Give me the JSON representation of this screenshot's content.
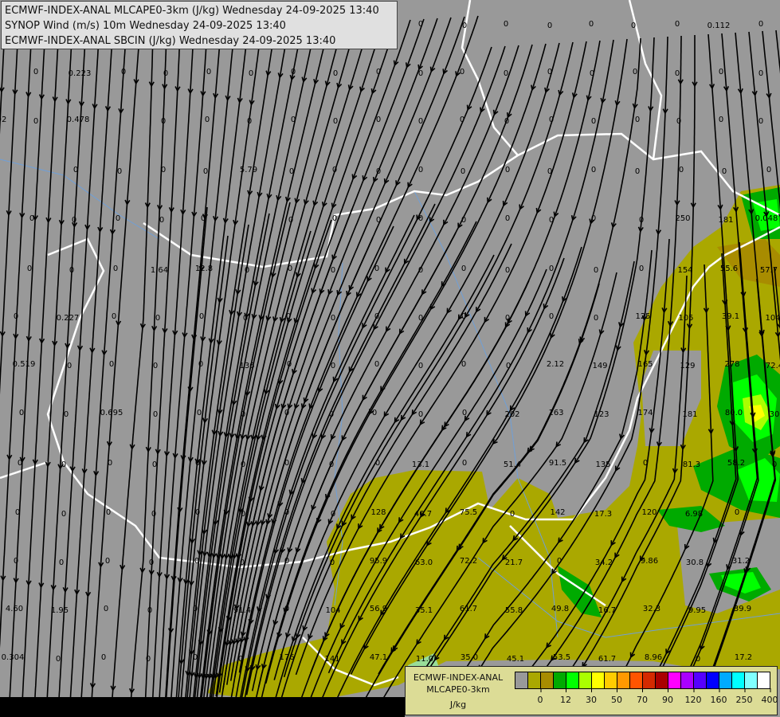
{
  "header": {
    "lines": [
      "ECMWF-INDEX-ANAL MLCAPE0-3km (J/kg) Wednesday 24-09-2025 13:40",
      "SYNOP Wind (m/s) 10m Wednesday 24-09-2025 13:40",
      "ECMWF-INDEX-ANAL SBCIN (J/kg) Wednesday 24-09-2025 13:40"
    ]
  },
  "colorbar": {
    "title_lines": [
      "ECMWF-INDEX-ANAL",
      "MLCAPE0-3km",
      "J/kg"
    ],
    "colors": [
      "#999999",
      "#aaa800",
      "#a88c00",
      "#00aa00",
      "#00ff00",
      "#aaff00",
      "#ffff00",
      "#ffcc00",
      "#ff9900",
      "#ff5500",
      "#d42a00",
      "#aa0000",
      "#ff00ff",
      "#aa00ff",
      "#5500ff",
      "#0000ff",
      "#00aaff",
      "#00ffff",
      "#80ffff",
      "#ffffff"
    ],
    "ticks": [
      "0",
      "12",
      "30",
      "50",
      "70",
      "90",
      "120",
      "160",
      "250",
      "400"
    ]
  },
  "map": {
    "background_color": "#999999",
    "cape_low_color": "#aaa800",
    "border_color": "#ffffff",
    "streamline_color": "#000000",
    "sbcin_values": [
      [
        "0",
        "0",
        "0",
        "0",
        "0",
        "0",
        "0",
        "0.112",
        "0"
      ],
      [
        "0",
        "0.223",
        "0",
        "0",
        "0",
        "0",
        "0",
        "0",
        "0",
        "0",
        "0",
        "0",
        "0",
        "0",
        "0",
        "0",
        "0",
        "0"
      ],
      [
        "02",
        "0",
        "0.478",
        "0",
        "0",
        "0",
        "0",
        "0",
        "0",
        "0",
        "0",
        "0",
        "0",
        "0",
        "0",
        "0",
        "0",
        "0"
      ],
      [
        "0",
        "0",
        "0",
        "0",
        "5.79",
        "0",
        "0",
        "0",
        "0",
        "0",
        "0",
        "0",
        "0",
        "0",
        "0",
        "0",
        "0"
      ],
      [
        "0",
        "0",
        "0",
        "0",
        "0",
        "0",
        "0",
        "0",
        "0",
        "0",
        "0",
        "0",
        "0",
        "0",
        "250",
        "181",
        "0.048"
      ],
      [
        "0",
        "0",
        "0",
        "1.64",
        "12.8",
        "0",
        "0",
        "0",
        "0",
        "0",
        "0",
        "0",
        "0",
        "0",
        "0",
        "154",
        "55.6",
        "57.7"
      ],
      [
        "0",
        "0.227",
        "0",
        "0",
        "0",
        "0",
        "0",
        "0",
        "0",
        "0",
        "0",
        "0",
        "0",
        "0",
        "125",
        "105",
        "39.1",
        "104"
      ],
      [
        "0.519",
        "0",
        "0",
        "0",
        "0",
        "136",
        "0",
        "0",
        "0",
        "0",
        "0",
        "0",
        "2.12",
        "149",
        "165",
        "129",
        "278",
        "72.4"
      ],
      [
        "0",
        "0",
        "0.695",
        "0",
        "0",
        "0",
        "0",
        "0",
        "0",
        "0",
        "0",
        "202",
        "163",
        "123",
        "174",
        "181",
        "80.0",
        "30"
      ],
      [
        "0",
        "0",
        "0",
        "0",
        "0",
        "0",
        "0",
        "0",
        "0",
        "13.1",
        "0",
        "51.4",
        "91.5",
        "135",
        "0",
        "81.3",
        "58.2",
        "0"
      ],
      [
        "0",
        "0",
        "0",
        "0",
        "0",
        "0",
        "0",
        "0",
        "128",
        "40.7",
        "75.5",
        "0",
        "142",
        "17.3",
        "120",
        "6.98",
        "0"
      ],
      [
        "0",
        "0",
        "0",
        "0",
        "0",
        "0",
        "0",
        "0",
        "95.9",
        "63.0",
        "72.2",
        "21.7",
        "0",
        "34.2",
        "9.86",
        "30.8",
        "31.2"
      ],
      [
        "4.60",
        "1.95",
        "0",
        "0",
        "0",
        "91.4",
        "0",
        "104",
        "56.9",
        "35.1",
        "61.7",
        "55.8",
        "49.8",
        "16.7",
        "32.3",
        "9.95",
        "39.9"
      ],
      [
        "0.304",
        "0",
        "0",
        "0",
        "0",
        "0",
        "176",
        "141",
        "47.1",
        "11.0",
        "35.0",
        "45.1",
        "53.5",
        "61.7",
        "8.96",
        "0",
        "17.2"
      ]
    ]
  }
}
